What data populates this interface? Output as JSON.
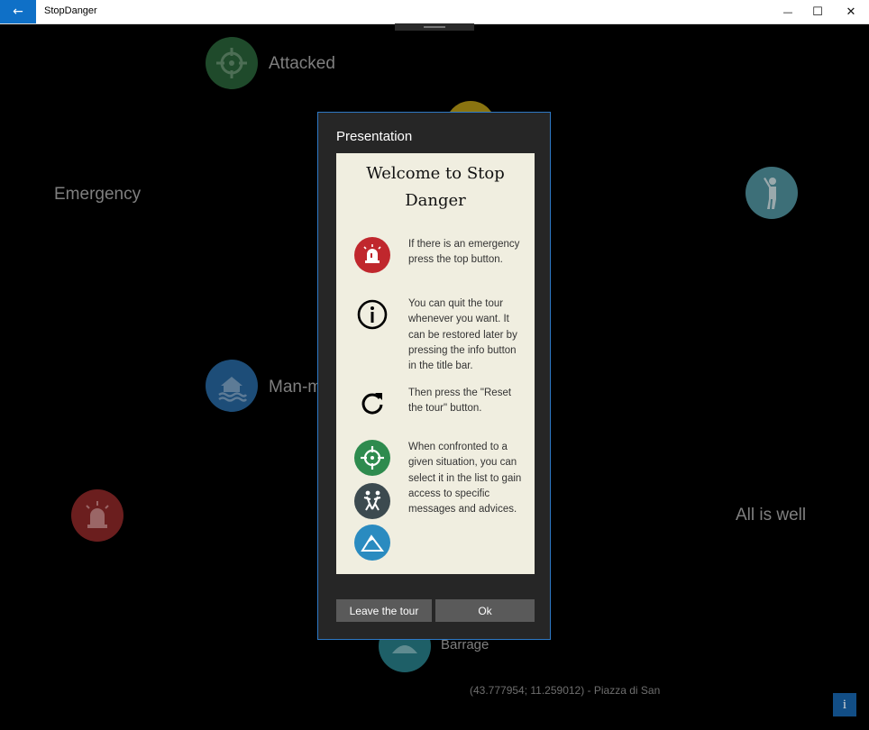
{
  "window": {
    "title": "StopDanger",
    "back_glyph": "←",
    "minimize_glyph": "—",
    "maximize_glyph": "☐",
    "close_glyph": "✕"
  },
  "background": {
    "labels": {
      "attacked": "Attacked",
      "emergency": "Emergency",
      "man_made": "Man-m",
      "all_is_well": "All is well",
      "barrage": "Barrage"
    },
    "location": "(43.777954; 11.259012) - Piazza di San",
    "info_button": "i",
    "colors": {
      "attacked": "#1f4a2b",
      "man_made": "#1d4d78",
      "emergency": "#6b1e1e",
      "all_is_well": "#3d6f78",
      "yellow": "#8a7410",
      "barrage": "#1e5f67"
    }
  },
  "dialog": {
    "title": "Presentation",
    "heading": "Welcome to Stop Danger",
    "items": [
      {
        "icon": "alarm-icon",
        "text": "If there is an emergency press the top button."
      },
      {
        "icon": "info-icon",
        "text": "You can quit the tour whenever you want. It can be restored later by pressing the info button in the title bar."
      },
      {
        "icon": "refresh-icon",
        "text": "Then press the \"Reset the tour\" button."
      },
      {
        "icon": "crosshair-icon",
        "text": "When confronted to a given situation, you can select it in the list to gain access to specific messages and advices."
      }
    ],
    "leave_button": "Leave the tour",
    "ok_button": "Ok",
    "colors": {
      "border": "#2e79c5",
      "alarm": "#c0272d",
      "crosshair": "#2e8b4e",
      "people": "#3c4a4f",
      "mountain": "#2a8bc0"
    }
  }
}
